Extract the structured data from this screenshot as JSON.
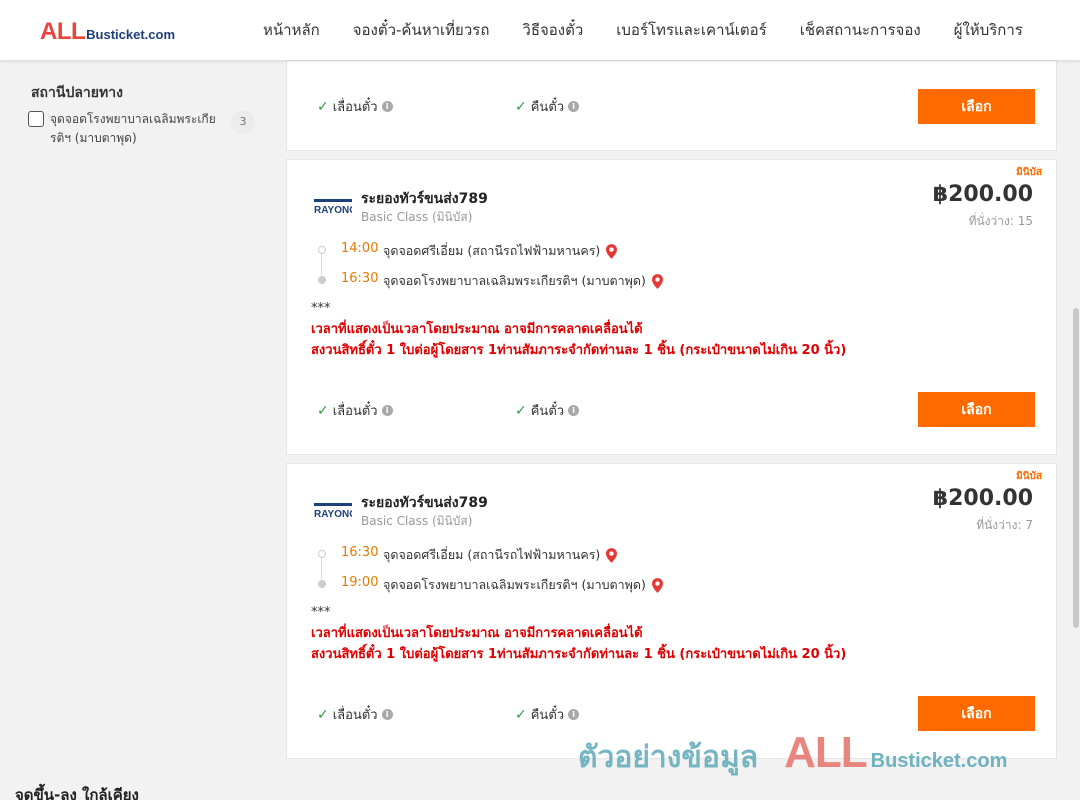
{
  "header": {
    "logo_big": "ALL",
    "logo_small": "Busticket.com",
    "nav": [
      "หน้าหลัก",
      "จองตั๋ว-ค้นหาเที่ยวรถ",
      "วิธีจองตั๋ว",
      "เบอร์โทรและเคาน์เตอร์",
      "เช็คสถานะการจอง",
      "ผู้ให้บริการ"
    ]
  },
  "sidebar": {
    "title": "สถานีปลายทาง",
    "filter_label": "จุดจอดโรงพยาบาลเฉลิมพระเกียรติฯ (มาบตาพุด)",
    "filter_count": "3",
    "filter_checked": false,
    "bottom_title": "จุดขึ้น-ลง ใกล้เคียง"
  },
  "top_card": {
    "feature_1": "เลื่อนตั๋ว",
    "feature_2": "คืนตั๋ว",
    "button": "เลือก"
  },
  "trips": [
    {
      "badge": "มินิบัส",
      "operator_logo": "RAYONG",
      "operator": "ระยองทัวร์ขนส่ง789",
      "class": "Basic Class (มินิบัส)",
      "price": "฿200.00",
      "seats": "ที่นั่งว่าง: 15",
      "depart_time": "14:00",
      "depart_stop": "จุดจอดศรีเอี่ยม (สถานีรถไฟฟ้ามหานคร)",
      "arrive_time": "16:30",
      "arrive_stop": "จุดจอดโรงพยาบาลเฉลิมพระเกียรติฯ (มาบตาพุด)",
      "note_stars": "***",
      "note_1": "เวลาที่แสดงเป็นเวลาโดยประมาณ อาจมีการคลาดเคลื่อนได้",
      "note_2": "สงวนสิทธิ์ตั๋ว 1 ใบต่อผู้โดยสาร 1ท่านสัมภาระจำกัดท่านละ 1 ชิ้น (กระเป๋าขนาดไม่เกิน 20 นิ้ว)",
      "feature_1": "เลื่อนตั๋ว",
      "feature_2": "คืนตั๋ว",
      "button": "เลือก"
    },
    {
      "badge": "มินิบัส",
      "operator_logo": "RAYONG",
      "operator": "ระยองทัวร์ขนส่ง789",
      "class": "Basic Class (มินิบัส)",
      "price": "฿200.00",
      "seats": "ที่นั่งว่าง: 7",
      "depart_time": "16:30",
      "depart_stop": "จุดจอดศรีเอี่ยม (สถานีรถไฟฟ้ามหานคร)",
      "arrive_time": "19:00",
      "arrive_stop": "จุดจอดโรงพยาบาลเฉลิมพระเกียรติฯ (มาบตาพุด)",
      "note_stars": "***",
      "note_1": "เวลาที่แสดงเป็นเวลาโดยประมาณ อาจมีการคลาดเคลื่อนได้",
      "note_2": "สงวนสิทธิ์ตั๋ว 1 ใบต่อผู้โดยสาร 1ท่านสัมภาระจำกัดท่านละ 1 ชิ้น (กระเป๋าขนาดไม่เกิน 20 นิ้ว)",
      "feature_1": "เลื่อนตั๋ว",
      "feature_2": "คืนตั๋ว",
      "button": "เลือก"
    }
  ],
  "watermark": {
    "text": "ตัวอย่างข้อมูล",
    "brand_big": "ALL",
    "brand_small": "Busticket.com"
  },
  "colors": {
    "accent": "#ff6a00",
    "time": "#e67a00",
    "warning": "#e00000",
    "check": "#2e9b3a",
    "pin": "#e53935"
  }
}
